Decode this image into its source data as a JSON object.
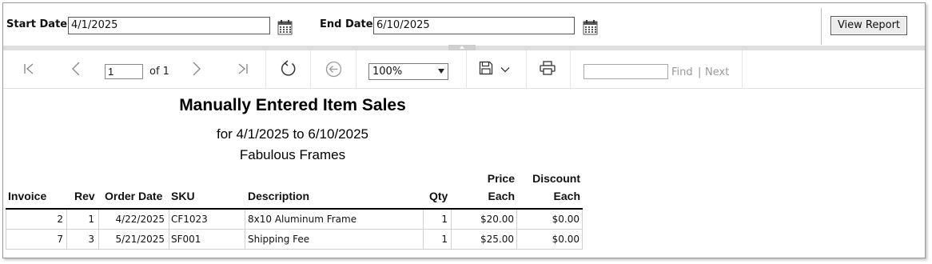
{
  "parameters": {
    "start_date_label": "Start Date",
    "start_date_value": "4/1/2025",
    "end_date_label": "End Date",
    "end_date_value": "6/10/2025",
    "view_report_label": "View Report"
  },
  "toolbar": {
    "page_value": "1",
    "page_of_text": "of 1",
    "zoom_value": "100%",
    "find_label": "Find",
    "find_separator": "|",
    "next_label": "Next"
  },
  "report": {
    "title": "Manually Entered Item Sales",
    "date_range": "for 4/1/2025 to 6/10/2025",
    "company": "Fabulous Frames",
    "columns": {
      "invoice": "Invoice",
      "rev": "Rev",
      "order_date": "Order Date",
      "sku": "SKU",
      "description": "Description",
      "qty": "Qty",
      "price_line1": "Price",
      "price_line2": "Each",
      "discount_line1": "Discount",
      "discount_line2": "Each"
    },
    "rows": [
      {
        "invoice": "2",
        "rev": "1",
        "order_date": "4/22/2025",
        "sku": "CF1023",
        "description": "8x10 Aluminum Frame",
        "qty": "1",
        "price": "$20.00",
        "discount": "$0.00"
      },
      {
        "invoice": "7",
        "rev": "3",
        "order_date": "5/21/2025",
        "sku": "SF001",
        "description": "Shipping Fee",
        "qty": "1",
        "price": "$25.00",
        "discount": "$0.00"
      }
    ]
  },
  "icons": {
    "first_page": "first-page-icon",
    "prev_page": "previous-page-icon",
    "next_page": "next-page-icon",
    "last_page": "last-page-icon",
    "refresh": "refresh-icon",
    "back": "back-icon",
    "save": "save-icon",
    "print": "print-icon",
    "calendar": "calendar-icon"
  }
}
